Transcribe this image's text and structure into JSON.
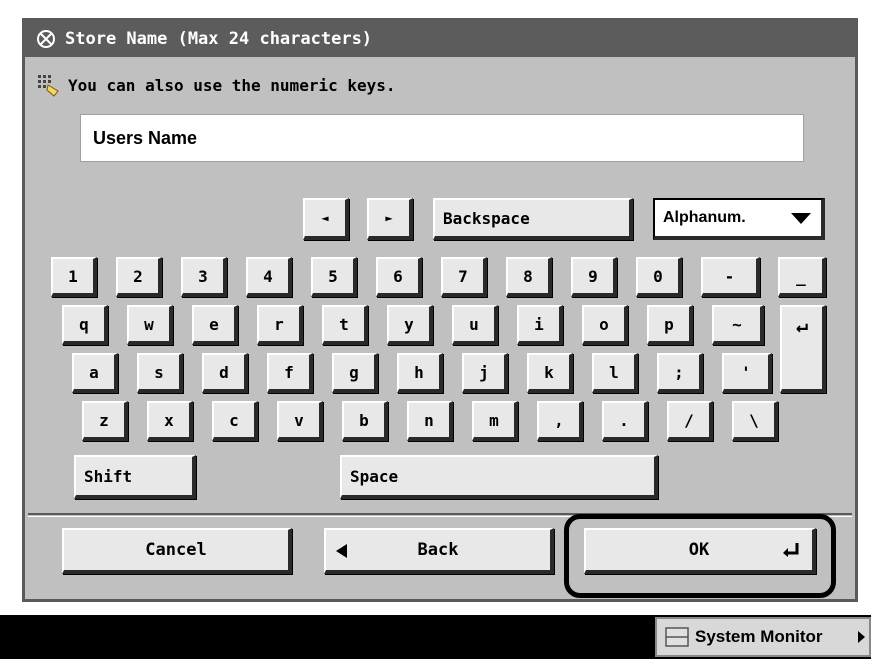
{
  "title": "Store Name (Max 24 characters)",
  "hint": "You can also use the numeric keys.",
  "input": {
    "value": "Users Name"
  },
  "controls": {
    "left_arrow": "◄",
    "right_arrow": "►",
    "backspace": "Backspace",
    "mode": "Alphanum."
  },
  "keyboard": {
    "row1": [
      "1",
      "2",
      "3",
      "4",
      "5",
      "6",
      "7",
      "8",
      "9",
      "0",
      "-",
      "_"
    ],
    "row2": [
      "q",
      "w",
      "e",
      "r",
      "t",
      "y",
      "u",
      "i",
      "o",
      "p",
      "~"
    ],
    "row3": [
      "a",
      "s",
      "d",
      "f",
      "g",
      "h",
      "j",
      "k",
      "l",
      ";",
      "'"
    ],
    "row4": [
      "z",
      "x",
      "c",
      "v",
      "b",
      "n",
      "m",
      ",",
      ".",
      "/",
      "\\"
    ],
    "shift": "Shift",
    "space": "Space",
    "enter": "↵"
  },
  "footer": {
    "cancel": "Cancel",
    "back": "Back",
    "ok": "OK"
  },
  "status": {
    "system_monitor": "System Monitor"
  },
  "colors": {
    "panel": "#c0c0c0",
    "titlebar": "#5c5c5c",
    "key": "#e8e8e8"
  }
}
